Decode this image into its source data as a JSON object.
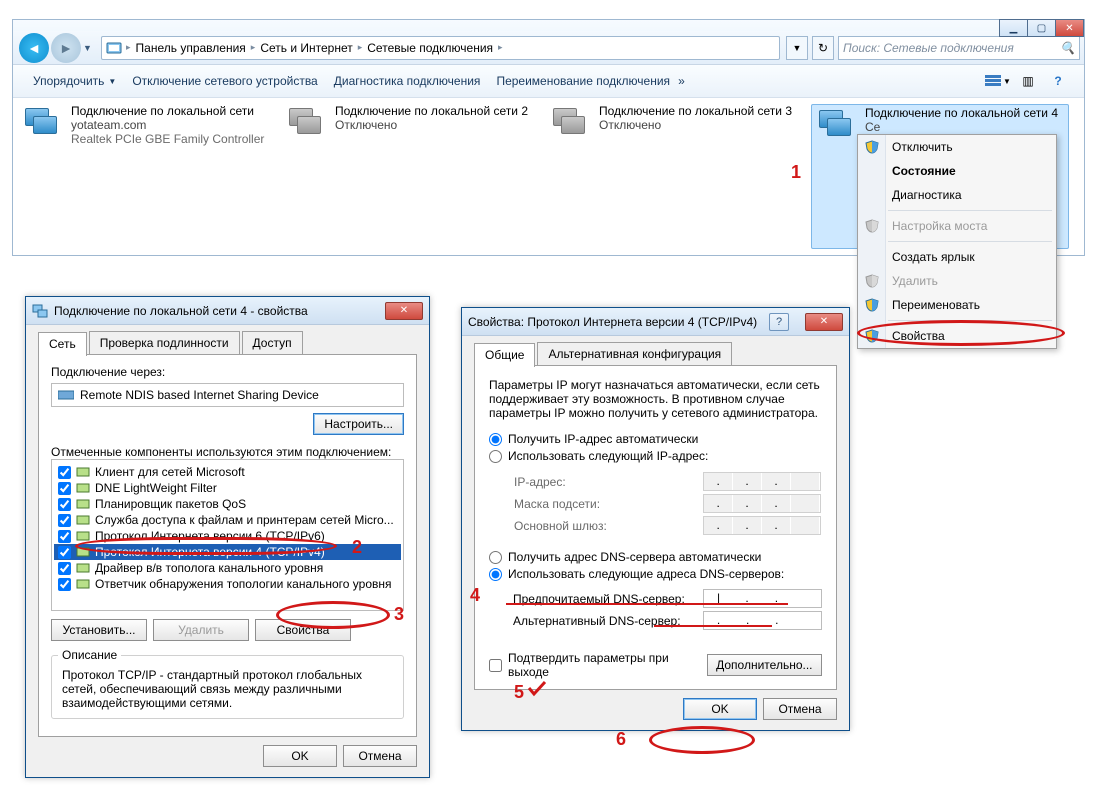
{
  "explorer": {
    "breadcrumbs": [
      "Панель управления",
      "Сеть и Интернет",
      "Сетевые подключения"
    ],
    "search_placeholder": "Поиск: Сетевые подключения",
    "toolbar": {
      "organize": "Упорядочить",
      "disable": "Отключение сетевого устройства",
      "diagnose": "Диагностика подключения",
      "rename": "Переименование подключения"
    },
    "connections": [
      {
        "title": "Подключение по локальной сети",
        "sub1": "yotateam.com",
        "sub2": "Realtek PCIe GBE Family Controller"
      },
      {
        "title": "Подключение по локальной сети 2",
        "sub1": "Отключено",
        "sub2": ""
      },
      {
        "title": "Подключение по локальной сети 3",
        "sub1": "Отключено",
        "sub2": ""
      },
      {
        "title": "Подключение по локальной сети 4",
        "sub1": "Се",
        "sub2": ""
      }
    ]
  },
  "context_menu": {
    "items": [
      {
        "label": "Отключить",
        "shield": true,
        "bold": false,
        "dis": false
      },
      {
        "label": "Состояние",
        "shield": false,
        "bold": true,
        "dis": false
      },
      {
        "label": "Диагностика",
        "shield": false,
        "bold": false,
        "dis": false
      },
      {
        "sep": true
      },
      {
        "label": "Настройка моста",
        "shield": true,
        "bold": false,
        "dis": true
      },
      {
        "sep": true
      },
      {
        "label": "Создать ярлык",
        "shield": false,
        "bold": false,
        "dis": false
      },
      {
        "label": "Удалить",
        "shield": true,
        "bold": false,
        "dis": true
      },
      {
        "label": "Переименовать",
        "shield": true,
        "bold": false,
        "dis": false
      },
      {
        "sep": true
      },
      {
        "label": "Свойства",
        "shield": true,
        "bold": false,
        "dis": false
      }
    ]
  },
  "dlg_prop": {
    "title": "Подключение по локальной сети 4 - свойства",
    "tabs": [
      "Сеть",
      "Проверка подлинности",
      "Доступ"
    ],
    "connect_via_label": "Подключение через:",
    "adapter": "Remote NDIS based Internet Sharing Device",
    "configure": "Настроить...",
    "components_label": "Отмеченные компоненты используются этим подключением:",
    "components": [
      "Клиент для сетей Microsoft",
      "DNE LightWeight Filter",
      "Планировщик пакетов QoS",
      "Служба доступа к файлам и принтерам сетей Micro...",
      "Протокол Интернета версии 6 (TCP/IPv6)",
      "Протокол Интернета версии 4 (TCP/IPv4)",
      "Драйвер в/в тополога канального уровня",
      "Ответчик обнаружения топологии канального уровня"
    ],
    "install": "Установить...",
    "uninstall": "Удалить",
    "properties": "Свойства",
    "description_label": "Описание",
    "description": "Протокол TCP/IP - стандартный протокол глобальных сетей, обеспечивающий связь между различными взаимодействующими сетями.",
    "ok": "OK",
    "cancel": "Отмена"
  },
  "dlg_ip": {
    "title": "Свойства: Протокол Интернета версии 4 (TCP/IPv4)",
    "tabs": [
      "Общие",
      "Альтернативная конфигурация"
    ],
    "intro": "Параметры IP могут назначаться автоматически, если сеть поддерживает эту возможность. В противном случае параметры IP можно получить у сетевого администратора.",
    "r_ip_auto": "Получить IP-адрес автоматически",
    "r_ip_manual": "Использовать следующий IP-адрес:",
    "ip_label": "IP-адрес:",
    "mask_label": "Маска подсети:",
    "gw_label": "Основной шлюз:",
    "r_dns_auto": "Получить адрес DNS-сервера автоматически",
    "r_dns_manual": "Использовать следующие адреса DNS-серверов:",
    "dns1_label": "Предпочитаемый DNS-сервер:",
    "dns2_label": "Альтернативный DNS-сервер:",
    "validate": "Подтвердить параметры при выходе",
    "advanced": "Дополнительно...",
    "ok": "OK",
    "cancel": "Отмена"
  },
  "annotations": {
    "n1": "1",
    "n2": "2",
    "n3": "3",
    "n4": "4",
    "n5": "5",
    "n6": "6"
  }
}
